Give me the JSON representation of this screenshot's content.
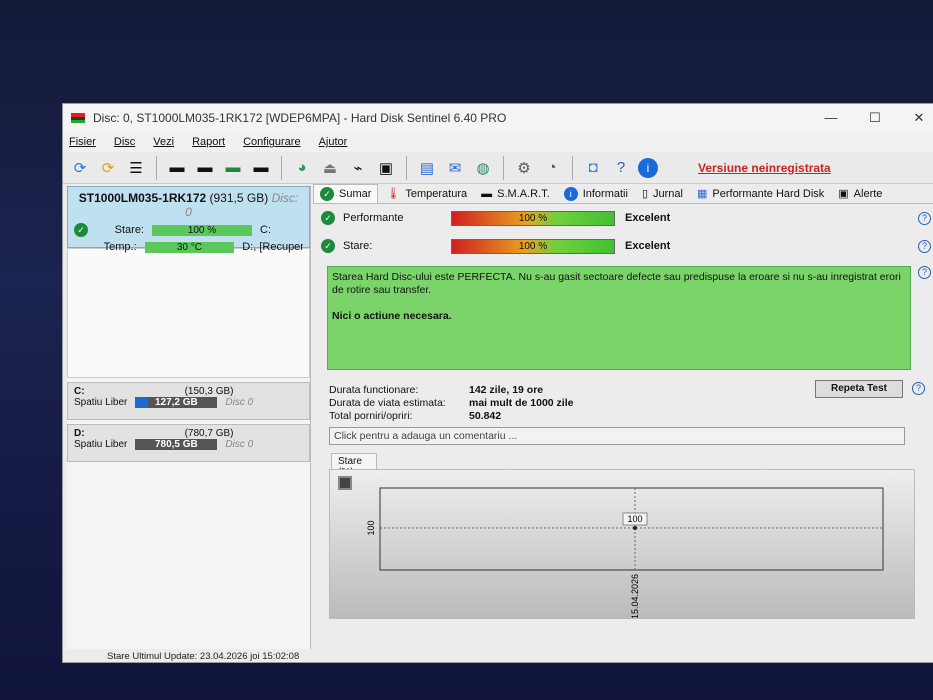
{
  "window": {
    "title": "Disc: 0, ST1000LM035-1RK172 [WDEP6MPA]  -  Hard Disk Sentinel 6.40 PRO",
    "controls": [
      "—",
      "☐",
      "✕"
    ]
  },
  "menu": [
    "Fisier",
    "Disc",
    "Vezi",
    "Raport",
    "Configurare",
    "Ajutor"
  ],
  "toolbar": {
    "unregistered": "Versiune neinregistrata"
  },
  "disk": {
    "name": "ST1000LM035-1RK172",
    "size": "(931,5 GB)",
    "disc": "Disc: 0",
    "stare_label": "Stare:",
    "stare_value": "100 %",
    "temp_label": "Temp.:",
    "temp_value": "30 °C",
    "drive1": "C:",
    "drive2": "D:, [Recupera"
  },
  "partitions": [
    {
      "letter": "C:",
      "size": "(150,3 GB)",
      "free_label": "Spatiu Liber",
      "free": "127,2 GB",
      "disc": "Disc 0"
    },
    {
      "letter": "D:",
      "size": "(780,7 GB)",
      "free_label": "Spatiu Liber",
      "free": "780,5 GB",
      "disc": "Disc 0"
    }
  ],
  "tabs": [
    "Sumar",
    "Temperatura",
    "S.M.A.R.T.",
    "Informatii",
    "Jurnal",
    "Performante Hard Disk",
    "Alerte"
  ],
  "metrics": [
    {
      "label": "Performante",
      "value": "100 %",
      "rating": "Excelent",
      "percent": 100
    },
    {
      "label": "Stare:",
      "value": "100 %",
      "rating": "Excelent",
      "percent": 100
    }
  ],
  "message": {
    "text": "Starea Hard Disc-ului este PERFECTA. Nu s-au gasit sectoare defecte sau predispuse la eroare si nu s-au inregistrat erori de rotire sau transfer.",
    "action": "Nici o actiune necesara."
  },
  "info": [
    {
      "key": "Durata functionare:",
      "value": "142 zile, 19 ore"
    },
    {
      "key": "Durata de viata estimata:",
      "value": "mai mult de 1000 zile"
    },
    {
      "key": "Total porniri/opriri:",
      "value": "50.842"
    }
  ],
  "repeat_button": "Repeta Test",
  "comment_placeholder": "Click pentru a adauga un comentariu ...",
  "chart_tab": "Stare (%)",
  "chart_data": {
    "type": "line",
    "title": "Stare (%)",
    "x": [
      "15.04.2026"
    ],
    "series": [
      {
        "name": "Stare",
        "values": [
          100
        ]
      }
    ],
    "ytick": "100",
    "point_label": "100"
  },
  "status": "Stare Ultimul Update: 23.04.2026 joi 15:02:08"
}
